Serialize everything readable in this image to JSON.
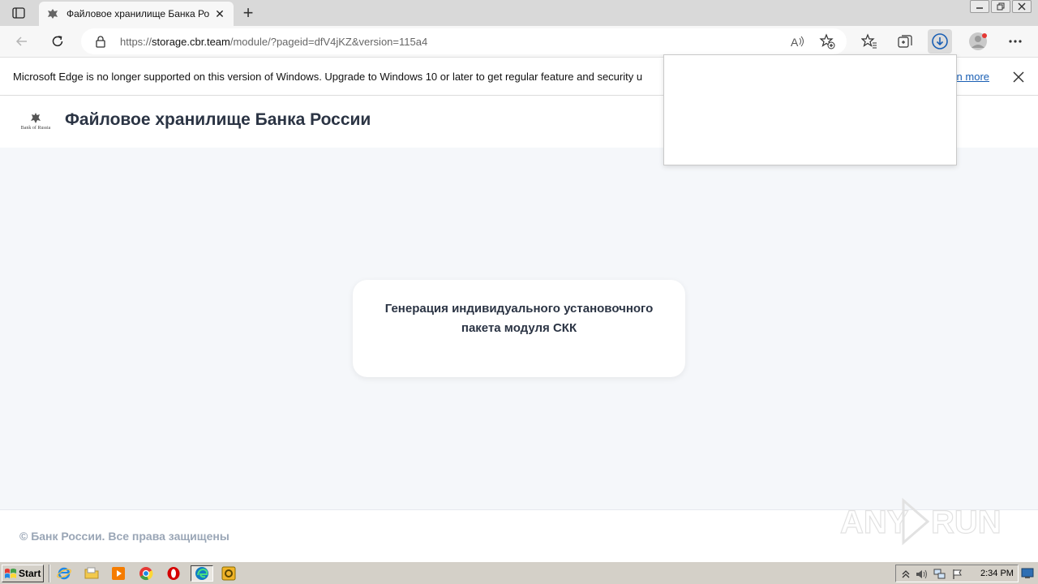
{
  "browser": {
    "tab": {
      "title": "Файловое хранилище Банка Ро",
      "close_glyph": "✕",
      "favicon": "bank-emblem-icon"
    },
    "new_tab_glyph": "+",
    "address": {
      "scheme": "https://",
      "host": "storage.cbr.team",
      "path": "/module/?pageid=dfV4jKZ&version=115a4"
    },
    "infobar": {
      "message": "Microsoft Edge is no longer supported on this version of Windows. Upgrade to Windows 10 or later to get regular feature and security u",
      "link": "arn more"
    },
    "icons": [
      "tab-actions-icon",
      "back-icon",
      "refresh-icon",
      "lock-icon",
      "read-aloud-icon",
      "add-favorite-icon",
      "favorites-icon",
      "collections-icon",
      "downloads-icon",
      "profile-icon",
      "more-icon",
      "close-icon"
    ],
    "accent_color": "#1a5fb4"
  },
  "site": {
    "logo_caption": "Bank of Russia",
    "title": "Файловое хранилище Банка России",
    "card_text": "Генерация индивидуального установочного пакета модуля СКК",
    "footer": "© Банк России. Все права защищены",
    "title_color": "#2b3444",
    "footer_color": "#9aa6b6",
    "watermark_text": "ANY.RUN"
  },
  "taskbar": {
    "start_label": "Start",
    "clock": "2:34 PM",
    "apps": [
      "ie-icon",
      "explorer-folder-icon",
      "media-player-icon",
      "chrome-icon",
      "opera-icon",
      "edge-icon",
      "outlook-icon"
    ]
  }
}
